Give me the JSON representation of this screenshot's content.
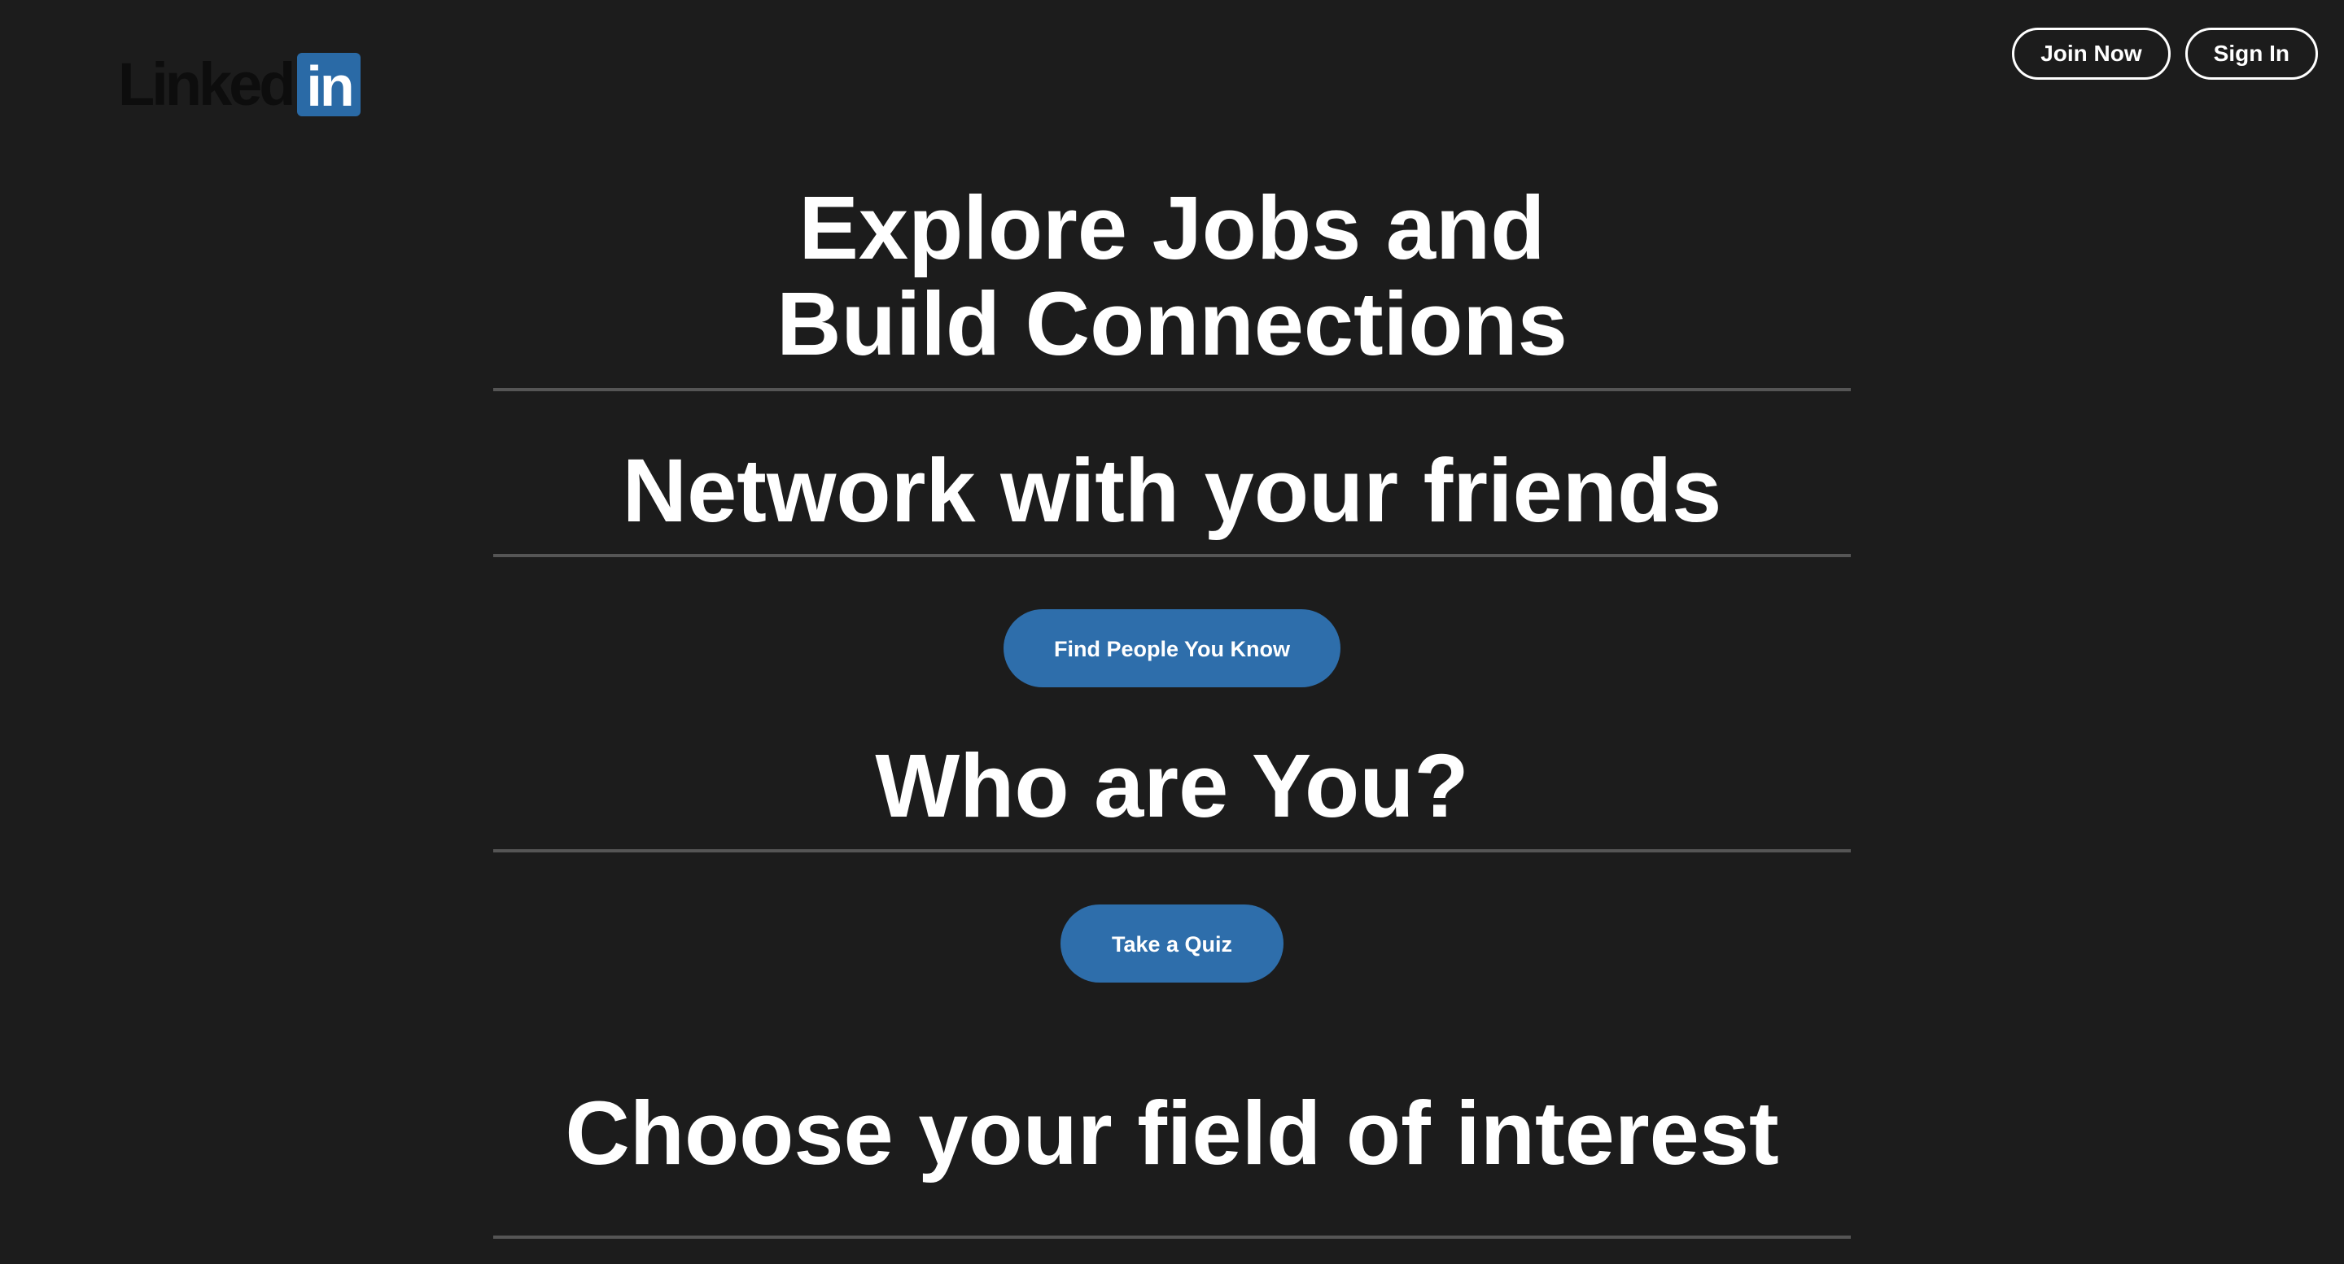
{
  "header": {
    "logo": {
      "word": "Linked",
      "badge": "in"
    },
    "join_label": "Join Now",
    "signin_label": "Sign In"
  },
  "main": {
    "hero_line1": "Explore Jobs and",
    "hero_line2": "Build Connections",
    "network_heading": "Network with your friends",
    "find_people_label": "Find People You Know",
    "who_heading": "Who are You?",
    "quiz_label": "Take a Quiz",
    "field_heading": "Choose your field of interest"
  },
  "colors": {
    "background": "#1c1c1c",
    "accent": "#2e6eab",
    "divider": "#555555",
    "text": "#ffffff"
  }
}
